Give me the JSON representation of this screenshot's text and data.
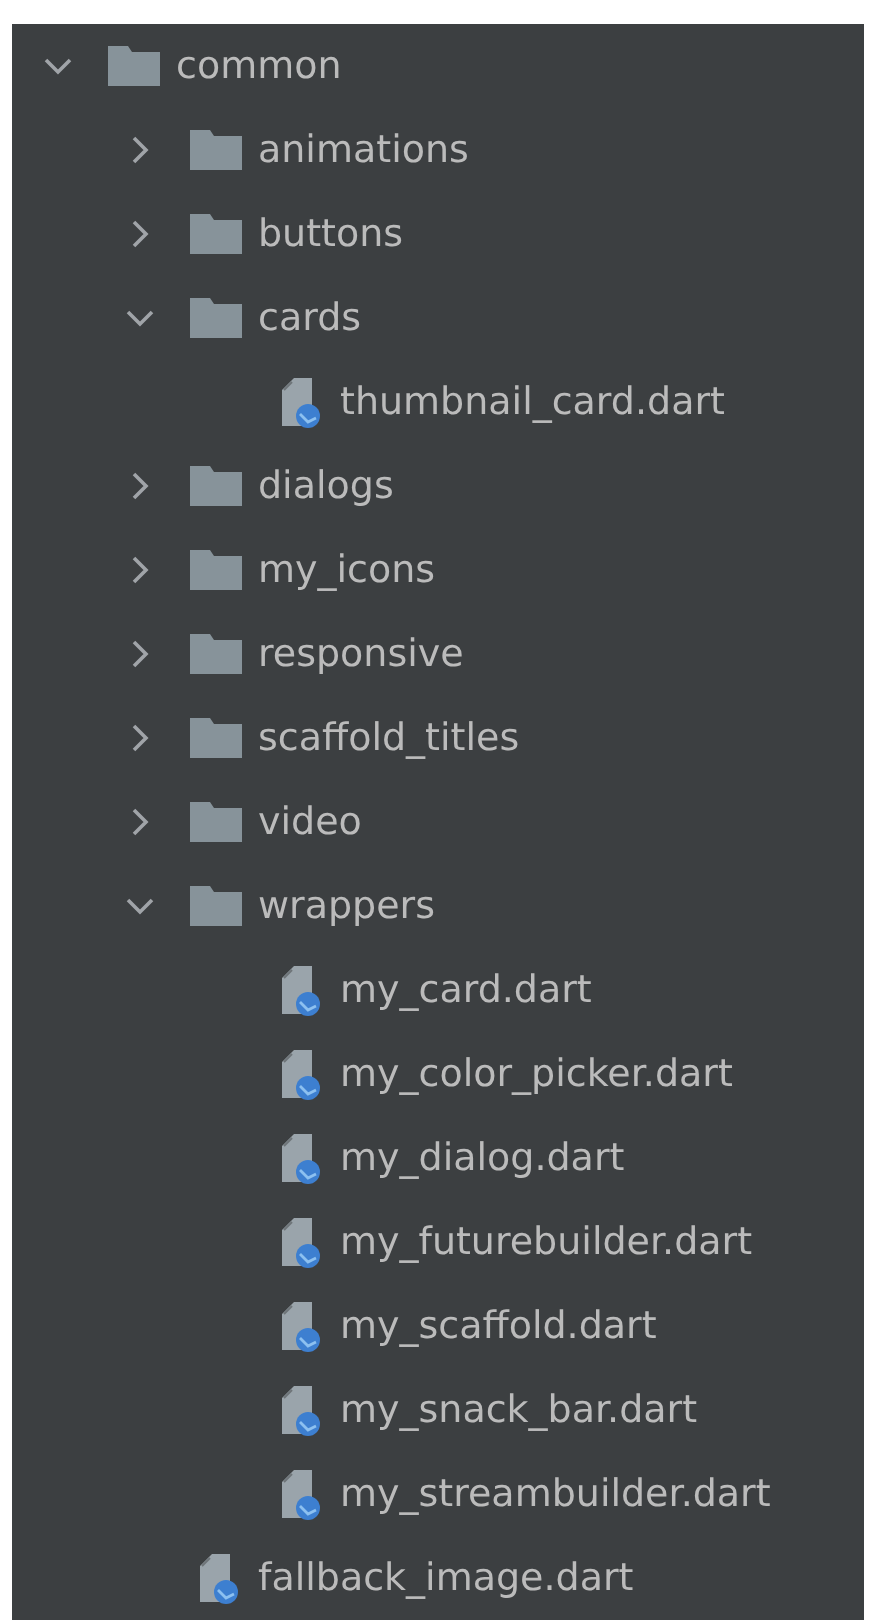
{
  "tree": [
    {
      "kind": "folder",
      "name": "common",
      "expanded": true,
      "children": [
        {
          "kind": "folder",
          "name": "animations",
          "expanded": false
        },
        {
          "kind": "folder",
          "name": "buttons",
          "expanded": false
        },
        {
          "kind": "folder",
          "name": "cards",
          "expanded": true,
          "children": [
            {
              "kind": "file",
              "name": "thumbnail_card.dart"
            }
          ]
        },
        {
          "kind": "folder",
          "name": "dialogs",
          "expanded": false
        },
        {
          "kind": "folder",
          "name": "my_icons",
          "expanded": false
        },
        {
          "kind": "folder",
          "name": "responsive",
          "expanded": false
        },
        {
          "kind": "folder",
          "name": "scaffold_titles",
          "expanded": false
        },
        {
          "kind": "folder",
          "name": "video",
          "expanded": false
        },
        {
          "kind": "folder",
          "name": "wrappers",
          "expanded": true,
          "children": [
            {
              "kind": "file",
              "name": "my_card.dart"
            },
            {
              "kind": "file",
              "name": "my_color_picker.dart"
            },
            {
              "kind": "file",
              "name": "my_dialog.dart"
            },
            {
              "kind": "file",
              "name": "my_futurebuilder.dart"
            },
            {
              "kind": "file",
              "name": "my_scaffold.dart"
            },
            {
              "kind": "file",
              "name": "my_snack_bar.dart"
            },
            {
              "kind": "file",
              "name": "my_streambuilder.dart"
            }
          ]
        },
        {
          "kind": "file",
          "name": "fallback_image.dart"
        }
      ]
    }
  ]
}
